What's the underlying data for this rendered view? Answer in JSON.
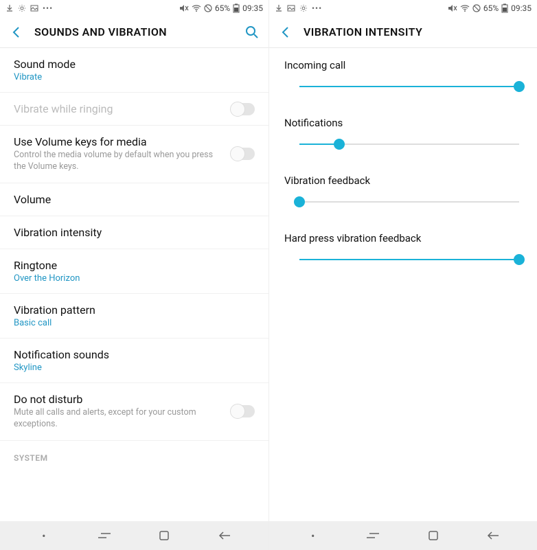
{
  "status": {
    "battery_pct": "65%",
    "time": "09:35"
  },
  "left": {
    "title": "SOUNDS AND VIBRATION",
    "items": {
      "sound_mode": {
        "label": "Sound mode",
        "value": "Vibrate"
      },
      "vibrate_while_ringing": {
        "label": "Vibrate while ringing"
      },
      "use_volume_keys": {
        "label": "Use Volume keys for media",
        "desc": "Control the media volume by default when you press the Volume keys."
      },
      "volume": {
        "label": "Volume"
      },
      "vibration_intensity": {
        "label": "Vibration intensity"
      },
      "ringtone": {
        "label": "Ringtone",
        "value": "Over the Horizon"
      },
      "vibration_pattern": {
        "label": "Vibration pattern",
        "value": "Basic call"
      },
      "notification_sounds": {
        "label": "Notification sounds",
        "value": "Skyline"
      },
      "dnd": {
        "label": "Do not disturb",
        "desc": "Mute all calls and alerts, except for your custom exceptions."
      },
      "system_header": "SYSTEM"
    }
  },
  "right": {
    "title": "VIBRATION INTENSITY",
    "sliders": {
      "incoming_call": {
        "label": "Incoming call",
        "percent": 100
      },
      "notifications": {
        "label": "Notifications",
        "percent": 18
      },
      "vibration_feedback": {
        "label": "Vibration feedback",
        "percent": 0
      },
      "hard_press": {
        "label": "Hard press vibration feedback",
        "percent": 100
      }
    }
  }
}
